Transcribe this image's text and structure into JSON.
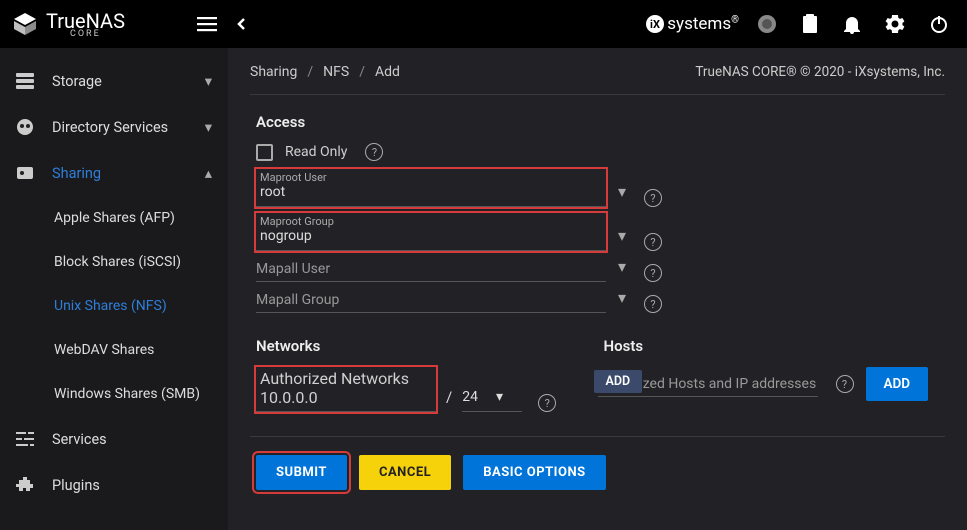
{
  "app": {
    "name": "TrueNAS",
    "edition": "CORE",
    "vendor": "iXsystems"
  },
  "breadcrumb": [
    "Sharing",
    "NFS",
    "Add"
  ],
  "copyright": "TrueNAS CORE® © 2020 - iXsystems, Inc.",
  "sidebar": {
    "storage": "Storage",
    "directory": "Directory Services",
    "sharing": "Sharing",
    "children": {
      "afp": "Apple Shares (AFP)",
      "iscsi": "Block Shares (iSCSI)",
      "nfs": "Unix Shares (NFS)",
      "webdav": "WebDAV Shares",
      "smb": "Windows Shares (SMB)"
    },
    "services": "Services",
    "plugins": "Plugins"
  },
  "access": {
    "title": "Access",
    "readonly_label": "Read Only",
    "maproot_user": {
      "label": "Maproot User",
      "value": "root"
    },
    "maproot_group": {
      "label": "Maproot Group",
      "value": "nogroup"
    },
    "mapall_user": {
      "label": "Mapall User",
      "value": ""
    },
    "mapall_group": {
      "label": "Mapall Group",
      "value": ""
    }
  },
  "networks": {
    "title": "Networks",
    "auth_label": "Authorized Networks",
    "auth_value": "10.0.0.0",
    "cidr": "24"
  },
  "hosts": {
    "title": "Hosts",
    "add_chip": "ADD",
    "placeholder": "Authorized Hosts and IP addresses",
    "add_button": "ADD"
  },
  "buttons": {
    "submit": "SUBMIT",
    "cancel": "CANCEL",
    "basic": "BASIC OPTIONS"
  }
}
